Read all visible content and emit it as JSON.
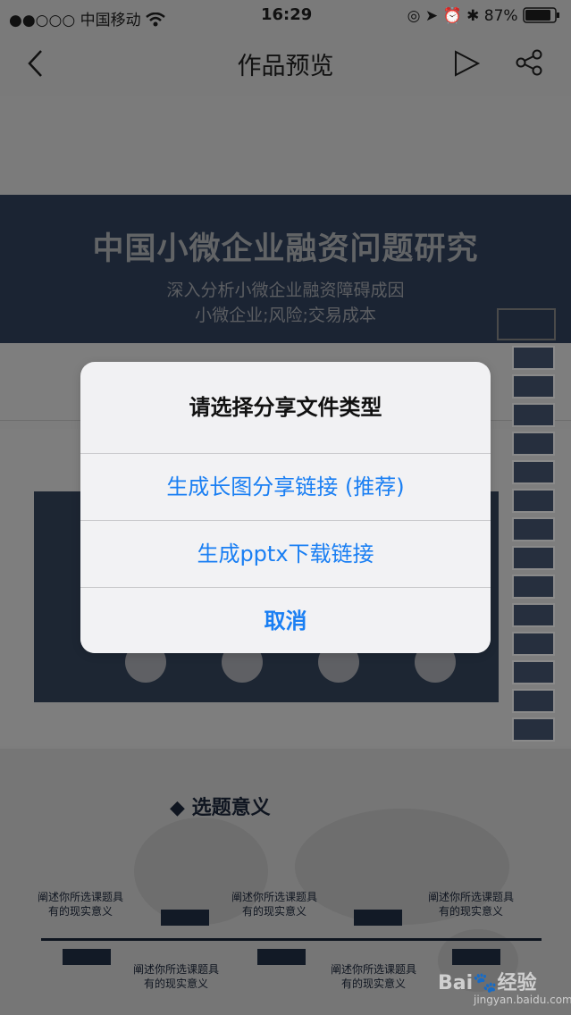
{
  "status_bar": {
    "signal": "●●○○○",
    "carrier": "中国移动",
    "time": "16:29",
    "battery": "87%"
  },
  "nav": {
    "title": "作品预览"
  },
  "slide1": {
    "title": "中国小微企业融资问题研究",
    "subtitle_line1": "深入分析小微企业融资障碍成因",
    "subtitle_line2": "小微企业;风险;交易成本"
  },
  "slide3": {
    "title": "◆ 选题意义",
    "timeline_text": "阐述你所选课题具有的现实意义"
  },
  "alert": {
    "title": "请选择分享文件类型",
    "option_long_image": "生成长图分享链接 (推荐)",
    "option_pptx": "生成pptx下载链接",
    "cancel": "取消"
  },
  "watermark": {
    "brand": "Bai🐾经验",
    "url": "jingyan.baidu.com"
  },
  "colors": {
    "alert_action": "#1a7ff3",
    "slide_dark": "#1b2433"
  }
}
